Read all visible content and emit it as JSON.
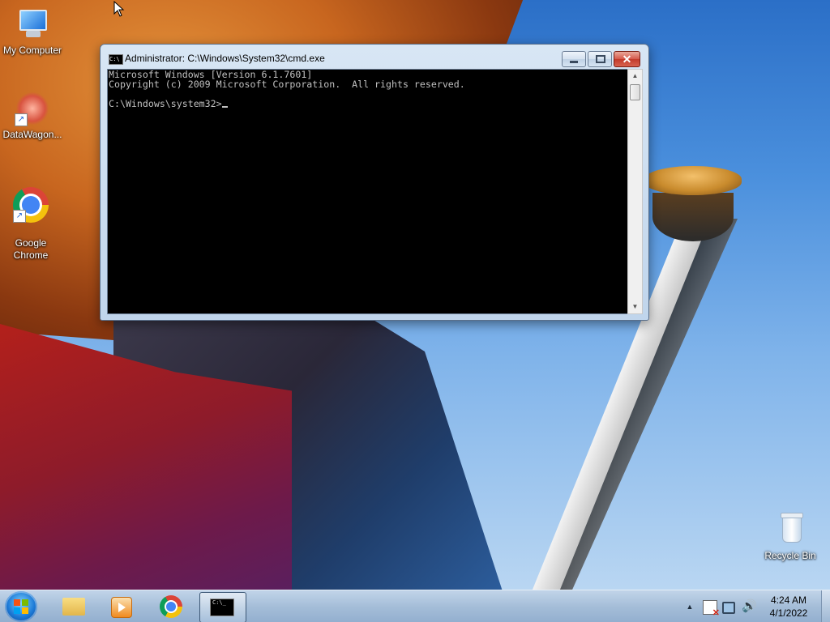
{
  "desktop": {
    "icons": [
      {
        "label": "My Computer"
      },
      {
        "label": "DataWagon..."
      },
      {
        "label": "Google\nChrome"
      },
      {
        "label": "Recycle Bin"
      }
    ]
  },
  "cmd_window": {
    "title": "Administrator: C:\\Windows\\System32\\cmd.exe",
    "title_icon_text": "C:\\",
    "controls": {
      "minimize": "–",
      "maximize": "□",
      "close": "✕"
    },
    "console_lines": [
      "Microsoft Windows [Version 6.1.7601]",
      "Copyright (c) 2009 Microsoft Corporation.  All rights reserved.",
      "",
      "C:\\Windows\\system32>"
    ],
    "scroll": {
      "up": "▲",
      "down": "▼"
    }
  },
  "taskbar": {
    "apps": [
      {
        "name": "windows-explorer"
      },
      {
        "name": "windows-media-player"
      },
      {
        "name": "google-chrome"
      },
      {
        "name": "command-prompt",
        "active": true,
        "icon_text": "C:\\_"
      }
    ],
    "tray": {
      "show_hidden": "▲",
      "volume_icon": "🔊"
    },
    "clock": {
      "time": "4:24 AM",
      "date": "4/1/2022"
    }
  }
}
